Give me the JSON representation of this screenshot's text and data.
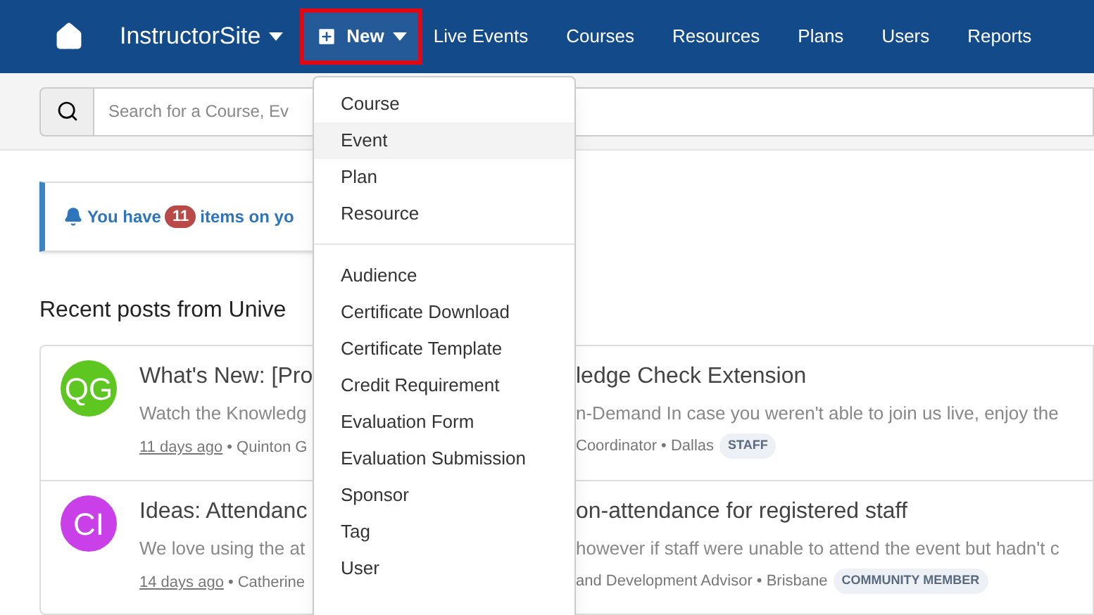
{
  "nav": {
    "site": "InstructorSite",
    "new_button": {
      "label": "New",
      "highlighted": true
    },
    "links": [
      "Live Events",
      "Courses",
      "Resources",
      "Plans",
      "Users",
      "Reports"
    ]
  },
  "search": {
    "placeholder": "Search for a Course, Ev"
  },
  "alert": {
    "before": "You have",
    "count": "11",
    "after": "items on yo"
  },
  "heading": "Recent posts from Unive",
  "posts": [
    {
      "initials": "QG",
      "color": "#5ec620",
      "title_left": "What's New: [Pro",
      "title_right": "ledge Check Extension",
      "body_left": "Watch the Knowledg",
      "body_right": "n-Demand In case you weren't able to join us live, enjoy the",
      "date": "11 days ago",
      "meta_left": "• Quinton G",
      "meta_right": "Coordinator • Dallas",
      "tag": "STAFF"
    },
    {
      "initials": "CI",
      "color": "#c93fe8",
      "title_left": "Ideas: Attendanc",
      "title_right": "on-attendance for registered staff",
      "body_left": "We love using the at",
      "body_right": "however if staff were unable to attend the event but hadn't c",
      "date": "14 days ago",
      "meta_left": "• Catherine",
      "meta_right": "and Development Advisor • Brisbane",
      "tag": "COMMUNITY MEMBER"
    }
  ],
  "menu": {
    "groups": [
      [
        {
          "label": "Course",
          "selected": false
        },
        {
          "label": "Event",
          "selected": true
        },
        {
          "label": "Plan",
          "selected": false
        },
        {
          "label": "Resource",
          "selected": false
        }
      ],
      [
        {
          "label": "Audience",
          "selected": false
        },
        {
          "label": "Certificate Download",
          "selected": false
        },
        {
          "label": "Certificate Template",
          "selected": false
        },
        {
          "label": "Credit Requirement",
          "selected": false
        },
        {
          "label": "Evaluation Form",
          "selected": false
        },
        {
          "label": "Evaluation Submission",
          "selected": false
        },
        {
          "label": "Sponsor",
          "selected": false
        },
        {
          "label": "Tag",
          "selected": false
        },
        {
          "label": "User",
          "selected": false
        }
      ]
    ]
  }
}
